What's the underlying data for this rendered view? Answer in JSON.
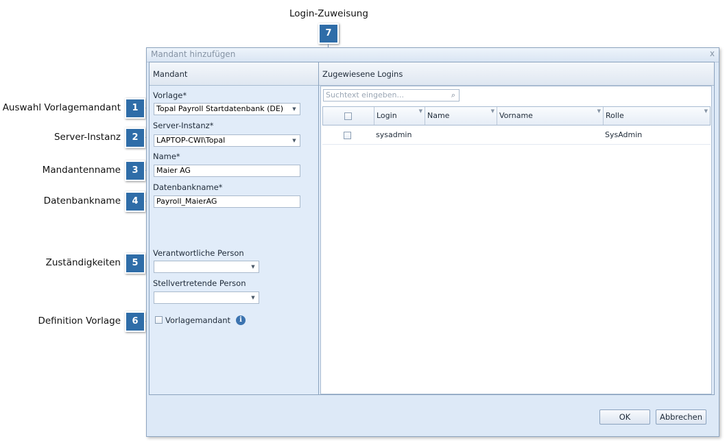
{
  "annotations": [
    {
      "number": "1",
      "label": "Auswahl Vorlagemandant"
    },
    {
      "number": "2",
      "label": "Server-Instanz"
    },
    {
      "number": "3",
      "label": "Mandantenname"
    },
    {
      "number": "4",
      "label": "Datenbankname"
    },
    {
      "number": "5",
      "label": "Zuständigkeiten"
    },
    {
      "number": "6",
      "label": "Definition Vorlage"
    },
    {
      "number": "7",
      "label": "Login-Zuweisung"
    }
  ],
  "dialog": {
    "title": "Mandant hinzufügen",
    "close_glyph": "x"
  },
  "left_panel": {
    "header": "Mandant",
    "vorlage_label": "Vorlage*",
    "vorlage_value": "Topal Payroll Startdatenbank (DE)",
    "server_label": "Server-Instanz*",
    "server_value": "LAPTOP-CWI\\Topal",
    "name_label": "Name*",
    "name_value": "Maier AG",
    "db_label": "Datenbankname*",
    "db_value": "Payroll_MaierAG",
    "verantwortlich_label": "Verantwortliche Person",
    "verantwortlich_value": "",
    "stellvertretend_label": "Stellvertretende Person",
    "stellvertretend_value": "",
    "vorlagemandant_label": "Vorlagemandant",
    "vorlagemandant_checked": false,
    "info_glyph": "i"
  },
  "right_panel": {
    "header": "Zugewiesene Logins",
    "search_placeholder": "Suchtext eingeben...",
    "columns": [
      "Login",
      "Name",
      "Vorname",
      "Rolle"
    ],
    "rows": [
      {
        "login": "sysadmin",
        "name": "",
        "vorname": "",
        "rolle": "SysAdmin"
      }
    ]
  },
  "buttons": {
    "ok": "OK",
    "cancel": "Abbrechen"
  },
  "colors": {
    "badge": "#2f6da8",
    "dialog_bg": "#dde9f7",
    "panel_border": "#8aa2be"
  }
}
